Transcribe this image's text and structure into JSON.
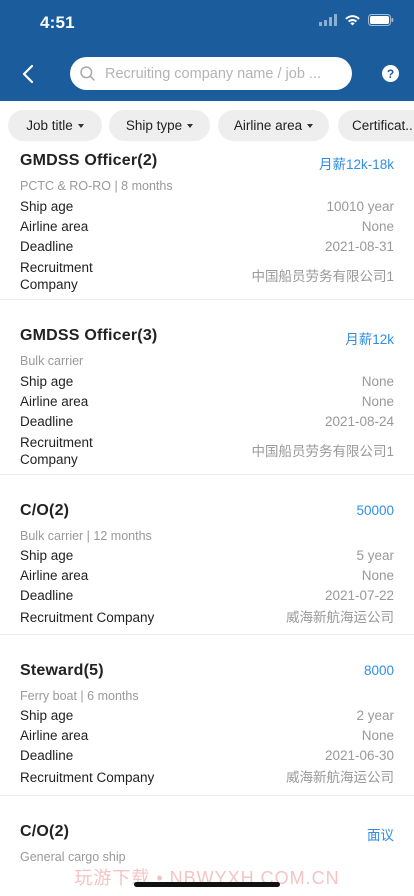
{
  "status_bar": {
    "time": "4:51"
  },
  "header": {
    "search_placeholder": "Recruiting company name / job ...",
    "help_label": "?"
  },
  "filters": [
    {
      "label": "Job title"
    },
    {
      "label": "Ship type"
    },
    {
      "label": "Airline area"
    },
    {
      "label": "Certificat..."
    }
  ],
  "jobs": [
    {
      "title": "GMDSS Officer(2)",
      "salary": "月薪12k-18k",
      "subtitle": "PCTC & RO-RO |  8  months",
      "ship_age_label": "Ship age",
      "ship_age": "10010 year",
      "area_label": "Airline area",
      "area": "None",
      "deadline_label": "Deadline",
      "deadline": "2021-08-31",
      "company_label": "Recruitment Company",
      "company": "中国船员劳务有限公司1"
    },
    {
      "title": "GMDSS Officer(3)",
      "salary": "月薪12k",
      "subtitle": "Bulk carrier",
      "ship_age_label": "Ship age",
      "ship_age": "None",
      "area_label": "Airline area",
      "area": "None",
      "deadline_label": "Deadline",
      "deadline": "2021-08-24",
      "company_label": "Recruitment Company",
      "company": "中国船员劳务有限公司1"
    },
    {
      "title": "C/O(2)",
      "salary": "50000",
      "subtitle": "Bulk carrier |  12  months",
      "ship_age_label": "Ship age",
      "ship_age": "5 year",
      "area_label": "Airline area",
      "area": "None",
      "deadline_label": "Deadline",
      "deadline": "2021-07-22",
      "company_label": "Recruitment Company",
      "company": "威海新航海运公司"
    },
    {
      "title": "Steward(5)",
      "salary": "8000",
      "subtitle": "Ferry boat |  6  months",
      "ship_age_label": "Ship age",
      "ship_age": "2 year",
      "area_label": "Airline area",
      "area": "None",
      "deadline_label": "Deadline",
      "deadline": "2021-06-30",
      "company_label": "Recruitment Company",
      "company": "威海新航海运公司"
    },
    {
      "title": "C/O(2)",
      "salary": "面议",
      "subtitle": "General cargo ship"
    }
  ],
  "watermark": "玩游下载 • NBWYXH.COM.CN",
  "colors": {
    "header_bg": "#1a5c9c",
    "accent": "#2f8ee6"
  }
}
